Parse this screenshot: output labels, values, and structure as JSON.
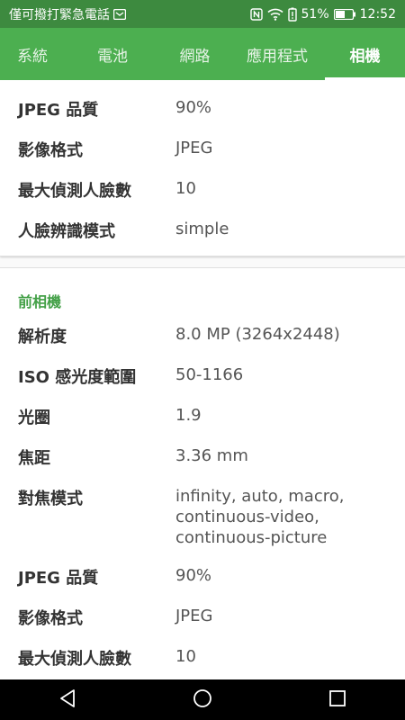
{
  "status_bar": {
    "carrier_text": "僅可撥打緊急電話",
    "battery_percent": "51%",
    "time": "12:52",
    "icons": [
      "message-icon",
      "nfc-icon",
      "wifi-icon",
      "battery-alert-icon",
      "battery-icon"
    ]
  },
  "tabs": [
    {
      "label": "系統",
      "active": false
    },
    {
      "label": "電池",
      "active": false
    },
    {
      "label": "網路",
      "active": false
    },
    {
      "label": "應用程式",
      "active": false
    },
    {
      "label": "相機",
      "active": true
    }
  ],
  "rear_camera_tail": [
    {
      "label": "JPEG 品質",
      "value": "90%"
    },
    {
      "label": "影像格式",
      "value": "JPEG"
    },
    {
      "label": "最大偵測人臉數",
      "value": "10"
    },
    {
      "label": "人臉辨識模式",
      "value": "simple"
    }
  ],
  "front_camera": {
    "title": "前相機",
    "rows": [
      {
        "label": "解析度",
        "value": "8.0 MP (3264x2448)"
      },
      {
        "label": "ISO 感光度範圍",
        "value": "50-1166"
      },
      {
        "label": "光圈",
        "value": "1.9"
      },
      {
        "label": "焦距",
        "value": "3.36 mm"
      },
      {
        "label": "對焦模式",
        "value": "infinity, auto, macro, continuous-video, continuous-picture"
      },
      {
        "label": "JPEG 品質",
        "value": "90%"
      },
      {
        "label": "影像格式",
        "value": "JPEG"
      },
      {
        "label": "最大偵測人臉數",
        "value": "10"
      }
    ]
  },
  "colors": {
    "status_bar": "#3d8a3f",
    "tab_bar": "#4caf50",
    "section_title": "#43a047"
  },
  "nav_bar": {
    "icons": [
      "back-icon",
      "home-icon",
      "recents-icon"
    ]
  }
}
